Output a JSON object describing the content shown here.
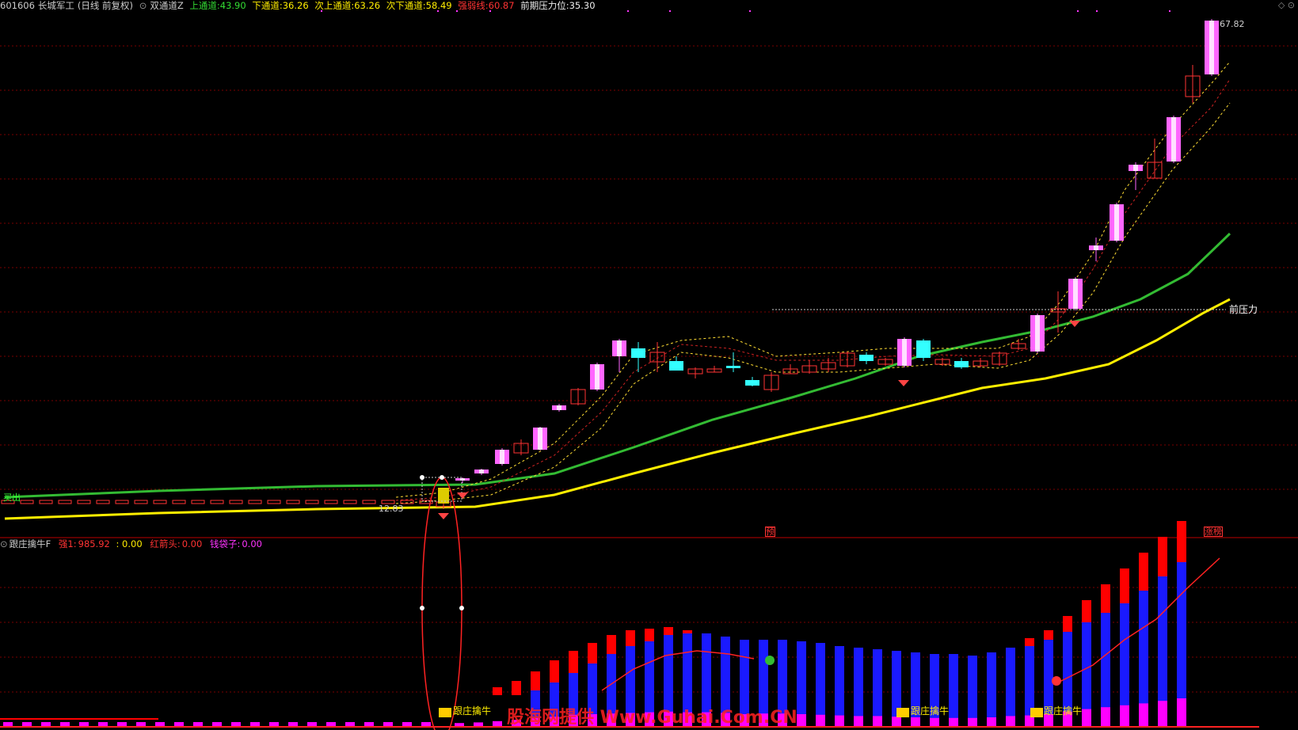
{
  "header": {
    "code": "601606",
    "name": "长城军工",
    "period": "(日线 前复权)",
    "indicator": "双通道Z",
    "upper_label": "上通道:",
    "upper_val": "43.90",
    "lower_label": "下通道:",
    "lower_val": "36.26",
    "next_upper_label": "次上通道:",
    "next_upper_val": "63.26",
    "next_lower_label": "次下通道:",
    "next_lower_val": "58.49",
    "strong_label": "强弱线:",
    "strong_val": "60.87",
    "pressure_label": "前期压力位:",
    "pressure_val": "35.30"
  },
  "main_chart": {
    "high_label": "67.82",
    "low_label": "12.83",
    "pressure_line_label": "前压力",
    "marker_yu": "预",
    "marker_zhangting": "涨榜",
    "buy_tag": "买出"
  },
  "sub_chart": {
    "indicator": "跟庄擒牛F",
    "strong1_label": "强1:",
    "strong1_val": "985.92",
    "colon_val": ": 0.00",
    "redhead_label": "红箭头:",
    "redhead_val": "0.00",
    "money_label": "钱袋子:",
    "money_val": "0.00",
    "signal_label_1": "跟庄擒牛",
    "signal_label_2": "跟庄擒牛",
    "signal_label_3": "跟庄擒牛",
    "watermark": "股海网提供 Www.Guhai.Com.CN"
  },
  "colors": {
    "background": "#000000",
    "grid": "#7a0000",
    "up_candle": "#ff3333",
    "down_candle": "#33ffff",
    "pink_candle": "#ff66ff",
    "green_line": "#33bb33",
    "yellow_line": "#ffee00",
    "red_bar": "#ff0000",
    "blue_bar": "#1a1aff",
    "magenta_bar": "#ff00ff"
  }
}
